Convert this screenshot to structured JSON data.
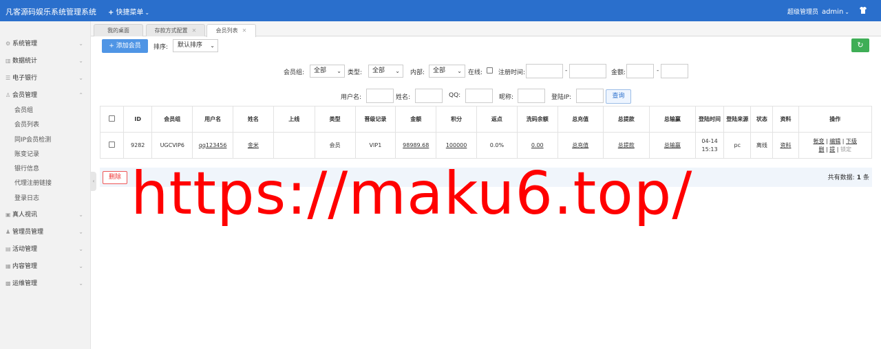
{
  "header": {
    "brand": "凡客源码娱乐系统管理系统",
    "quick_menu": "快捷菜单",
    "role": "超级管理员",
    "username": "admin"
  },
  "sidebar": {
    "menus": [
      {
        "label": "系统管理",
        "icon": "gear-icon"
      },
      {
        "label": "数据统计",
        "icon": "chart-icon"
      },
      {
        "label": "电子银行",
        "icon": "list-icon"
      },
      {
        "label": "会员管理",
        "icon": "user-icon",
        "expanded": true,
        "children": [
          "会员组",
          "会员列表",
          "同IP会员检测",
          "账变记录",
          "银行信息",
          "代理注册链接",
          "登录日志"
        ]
      },
      {
        "label": "真人视讯",
        "icon": "video-icon"
      },
      {
        "label": "管理员管理",
        "icon": "admin-icon"
      },
      {
        "label": "活动管理",
        "icon": "activity-icon"
      },
      {
        "label": "内容管理",
        "icon": "content-icon"
      },
      {
        "label": "运维管理",
        "icon": "ops-icon"
      }
    ]
  },
  "tabs": [
    "我的桌面",
    "存款方式配置",
    "会员列表"
  ],
  "toolbar": {
    "add_member": "添加会员",
    "sort_label": "排序:",
    "sort_value": "默认排序"
  },
  "filters": {
    "group_label": "会员组:",
    "group_value": "全部",
    "type_label": "类型:",
    "type_value": "全部",
    "internal_label": "内部:",
    "internal_value": "全部",
    "online_label": "在线:",
    "reg_time_label": "注册时间:",
    "dash": "-",
    "amount_label": "金额:",
    "username_label": "用户名:",
    "name_label": "姓名:",
    "qq_label": "QQ:",
    "nickname_label": "昵称:",
    "login_ip_label": "登陆IP:",
    "query_button": "查询"
  },
  "table": {
    "columns": [
      "ID",
      "会员组",
      "用户名",
      "姓名",
      "上线",
      "类型",
      "晋级记录",
      "金额",
      "积分",
      "返点",
      "洗码余额",
      "总充值",
      "总提款",
      "总输赢",
      "登陆时间",
      "登陆来源",
      "状态",
      "资料",
      "操作"
    ],
    "rows": [
      {
        "id": "9282",
        "group": "UGCVIP6",
        "username": "qq123456",
        "name": "金米",
        "upline": "",
        "type": "会员",
        "promotion": "VIP1",
        "amount": "98989.68",
        "points": "100000",
        "rebate": "0.0%",
        "wash_balance": "0.00",
        "total_recharge": "总充值",
        "total_withdraw": "总提款",
        "total_winloss": "总输赢",
        "login_time": "04-14 15:13",
        "login_source": "pc",
        "status": "离线",
        "profile": "资料",
        "op_account": "帐变",
        "op_edit": "编辑",
        "op_sub": "下级",
        "op_delete": "删",
        "op_lift": "提",
        "op_lock": "锁定"
      }
    ]
  },
  "footer": {
    "delete_button": "删除",
    "total_label": "共有数据:",
    "total_count": "1",
    "total_unit": "条"
  },
  "watermark": "https://maku6.top/",
  "colors": {
    "header": "#2a6fcc",
    "primary_button": "#4f95e5",
    "refresh_button": "#3fae56",
    "delete_border": "#e55555",
    "watermark": "#ff0000"
  }
}
